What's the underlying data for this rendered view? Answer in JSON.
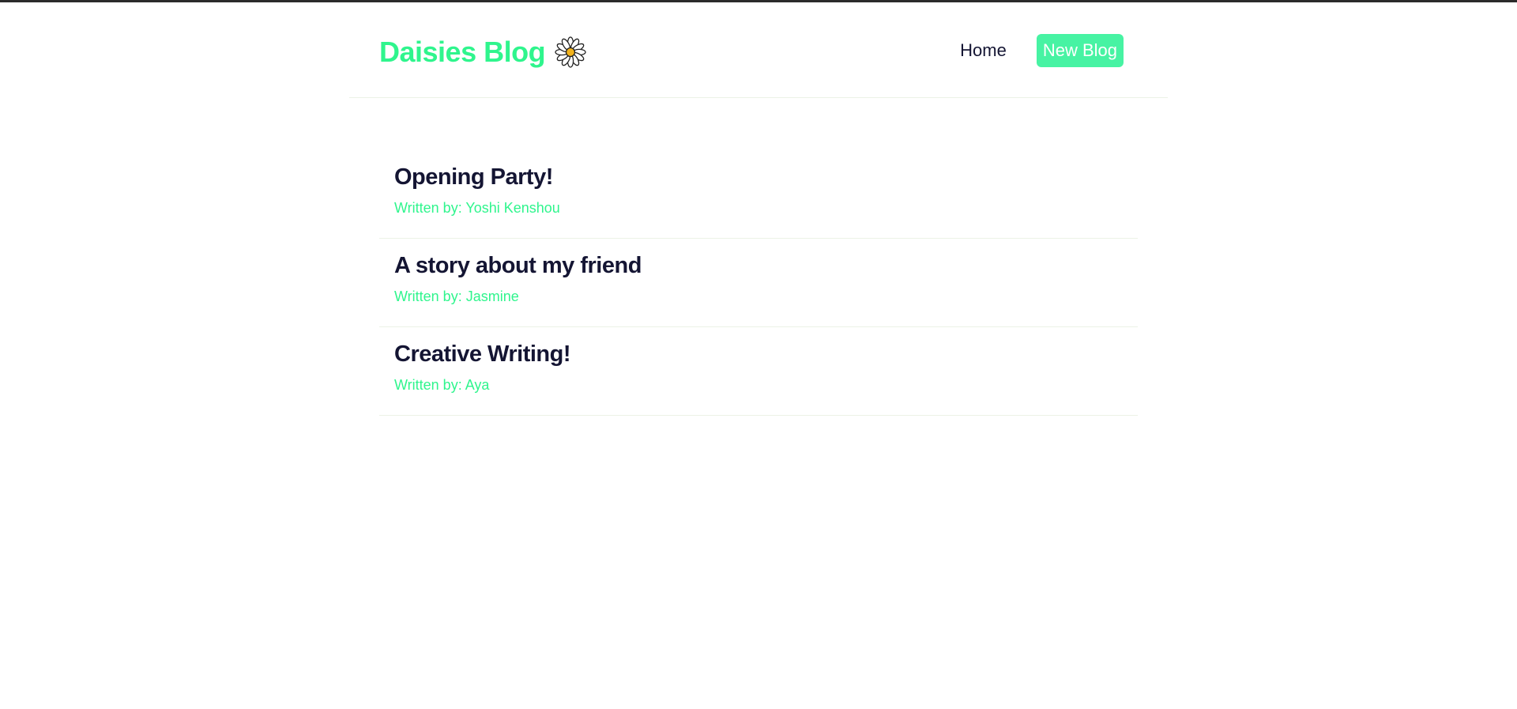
{
  "navbar": {
    "brand": "Daisies Blog",
    "brand_icon": "daisy-icon",
    "links": {
      "home": "Home",
      "new_blog": "New Blog"
    }
  },
  "blogs": [
    {
      "title": "Opening Party!",
      "author": "Written by: Yoshi Kenshou"
    },
    {
      "title": "A story about my friend",
      "author": "Written by: Jasmine"
    },
    {
      "title": "Creative Writing!",
      "author": "Written by: Aya"
    }
  ],
  "colors": {
    "accent": "#2ff58d",
    "button": "#47f3a3",
    "text": "#141533",
    "divider": "#ecf2e6"
  }
}
